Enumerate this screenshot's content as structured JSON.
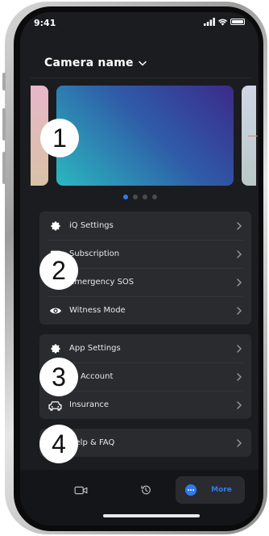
{
  "status_bar": {
    "time": "9:41"
  },
  "header": {
    "camera_name": "Camera name"
  },
  "carousel": {
    "page_count": 4,
    "active_index": 0
  },
  "badges": [
    "1",
    "2",
    "3",
    "4"
  ],
  "groups": [
    {
      "items": [
        {
          "label": "iQ Settings",
          "icon": "gear-icon"
        },
        {
          "label": "Subscription",
          "icon": "card-icon"
        },
        {
          "label": "Emergency SOS",
          "icon": "sos-icon"
        },
        {
          "label": "Witness Mode",
          "icon": "eye-icon"
        }
      ]
    },
    {
      "items": [
        {
          "label": "App Settings",
          "icon": "gear-icon"
        },
        {
          "label": "Account",
          "icon": "user-icon"
        },
        {
          "label": "Insurance",
          "icon": "car-icon"
        }
      ]
    },
    {
      "items": [
        {
          "label": "Help & FAQ",
          "icon": "help-icon"
        }
      ]
    }
  ],
  "tabbar": {
    "tabs": [
      {
        "name": "Video",
        "icon": "video-camera-icon"
      },
      {
        "name": "History",
        "icon": "history-icon"
      },
      {
        "name": "More",
        "label": "More",
        "icon": "more-icon",
        "active": true
      }
    ]
  },
  "colors": {
    "accent": "#2e7bf0",
    "background": "#1b1c1f",
    "card": "#2a2b2f"
  }
}
